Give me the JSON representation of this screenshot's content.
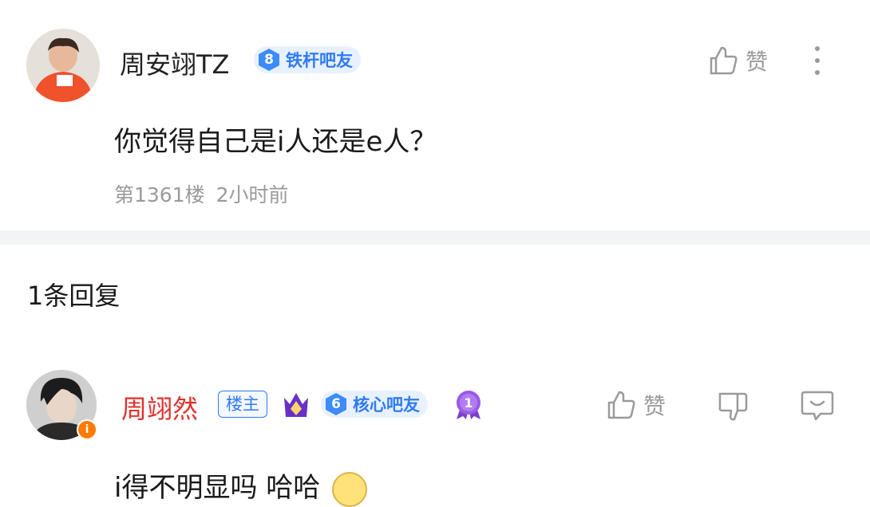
{
  "post": {
    "username": "周安翊TZ",
    "level": "8",
    "badge_label": "铁杆吧友",
    "like_label": "赞",
    "content": "你觉得自己是i人还是e人？",
    "floor": "第1361楼",
    "time": "2小时前"
  },
  "replies_header": "1条回复",
  "reply": {
    "username": "周翊然",
    "op_tag": "楼主",
    "level": "6",
    "badge_label": "核心吧友",
    "medal_number": "1",
    "like_label": "赞",
    "content_partial": "i得不明显吗 哈哈"
  },
  "colors": {
    "accent_blue": "#2f7bf5",
    "op_name_red": "#e0312c",
    "meta_gray": "#9a9a9a"
  }
}
